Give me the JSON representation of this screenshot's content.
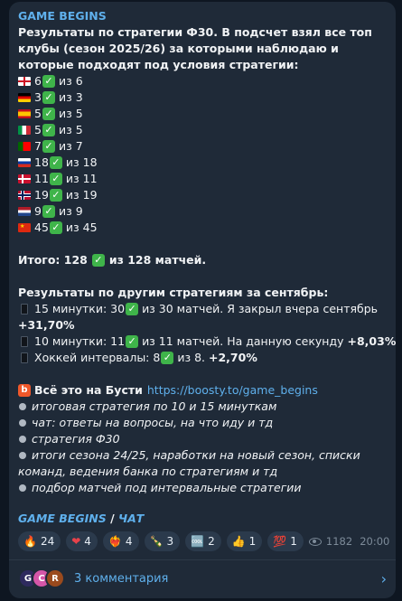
{
  "post": {
    "channel_name": "GAME BEGINS",
    "intro": "Результаты по стратегии Ф30. В подсчет взял все топ клубы (сезон 2025/26) за которыми наблюдаю и которые подходят под условия стратегии:",
    "flag_rows": [
      {
        "flag": "england",
        "count": "6",
        "total": "из 6"
      },
      {
        "flag": "germany",
        "count": "3",
        "total": "из 3"
      },
      {
        "flag": "spain",
        "count": "5",
        "total": "из 5"
      },
      {
        "flag": "italy",
        "count": "5",
        "total": "из 5"
      },
      {
        "flag": "portugal",
        "count": "7",
        "total": "из 7"
      },
      {
        "flag": "russia",
        "count": "18",
        "total": "из 18"
      },
      {
        "flag": "denmark",
        "count": "11",
        "total": "из 11"
      },
      {
        "flag": "norway",
        "count": "19",
        "total": "из 19"
      },
      {
        "flag": "netherlands",
        "count": "9",
        "total": "из 9"
      },
      {
        "flag": "china",
        "count": "45",
        "total": "из 45"
      }
    ],
    "total_prefix": "Итого: 128",
    "total_suffix": "из 128 матчей.",
    "other_heading": "Результаты по другим стратегиям за сентябрь:",
    "other_rows": [
      {
        "prefix": "15 минутки: 30",
        "suffix": "из 30 матчей. Я закрыл вчера сентябрь",
        "profit": "+31,70%"
      },
      {
        "prefix": "10 минутки: 11",
        "suffix": "из 11 матчей. На данную секунду",
        "profit": "+8,03%"
      },
      {
        "prefix": "Хоккей интервалы: 8",
        "suffix": "из 8.",
        "profit": "+2,70%"
      }
    ],
    "boosty_label": "Всё это на Бусти",
    "boosty_link": "https://boosty.to/game_begins",
    "bullets": [
      "итоговая стратегия по 10 и 15 минуткам",
      "чат: ответы на вопросы, на что иду и тд",
      "стратегия Ф30",
      "итоги сезона 24/25, наработки на новый сезон, списки команд, ведения банка по стратегиям и тд",
      "подбор матчей под интервальные стратегии"
    ],
    "footer_channel": "GAME BEGINS",
    "footer_sep": "/",
    "footer_chat": "ЧАТ"
  },
  "reactions": [
    {
      "icon": "fire-icon",
      "emoji": "🔥",
      "count": "24"
    },
    {
      "icon": "heart-icon",
      "emoji": "❤",
      "count": "4"
    },
    {
      "icon": "heart-on-fire-icon",
      "emoji": "❤‍🔥",
      "count": "4"
    },
    {
      "icon": "champagne-icon",
      "emoji": "🍾",
      "count": "3"
    },
    {
      "icon": "cool-icon",
      "emoji": "🆒",
      "count": "2"
    },
    {
      "icon": "thumbs-up-icon",
      "emoji": "👍",
      "count": "1"
    },
    {
      "icon": "hundred-icon",
      "emoji": "💯",
      "count": "1"
    }
  ],
  "meta": {
    "views": "1182",
    "time": "20:00"
  },
  "comments": {
    "label": "3 комментария",
    "avatars": [
      "G",
      "C",
      "R"
    ]
  },
  "colors": {
    "background": "#0e1621",
    "bubble": "#1f2a38",
    "accent": "#5fb0ec",
    "check": "#3fb44a"
  }
}
